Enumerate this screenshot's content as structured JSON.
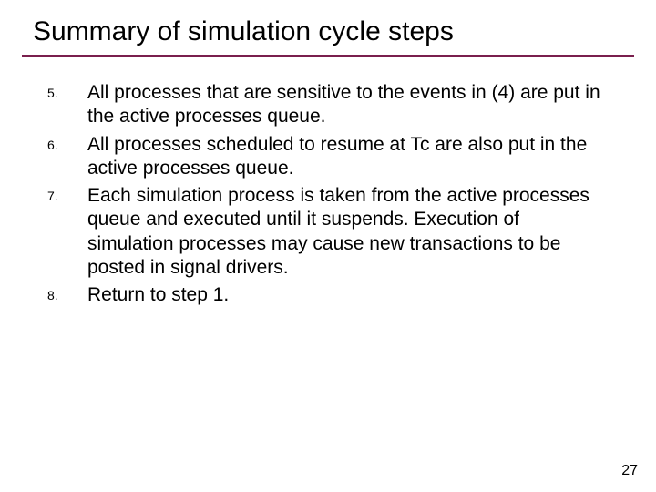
{
  "title": "Summary of simulation cycle steps",
  "accent_color": "#7a1f4d",
  "items": [
    {
      "num": "5.",
      "text": "All processes that are sensitive to the events in (4) are put in the active processes queue."
    },
    {
      "num": "6.",
      "text": "All processes scheduled to resume at Tc are also put in the active processes queue."
    },
    {
      "num": "7.",
      "text": "Each simulation process is taken from the active processes queue and executed until it suspends. Execution of simulation processes may cause new transactions to be posted in signal drivers."
    },
    {
      "num": "8.",
      "text": "Return to step 1."
    }
  ],
  "page_number": "27"
}
